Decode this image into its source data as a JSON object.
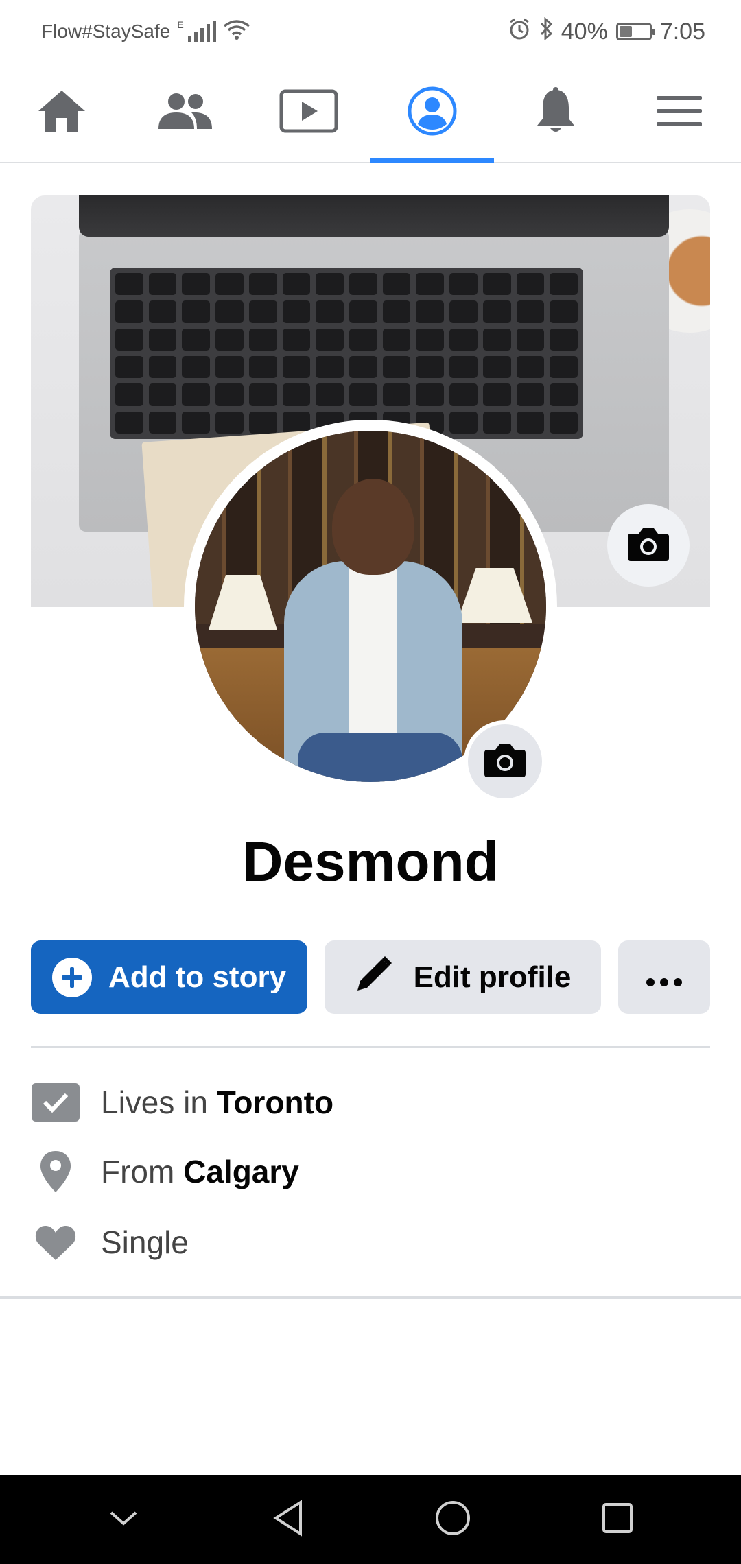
{
  "status_bar": {
    "carrier": "Flow#StaySafe",
    "network_type": "E",
    "battery_percent": "40%",
    "battery_level": 0.4,
    "time": "7:05",
    "icons": [
      "signal-icon",
      "wifi-icon",
      "alarm-icon",
      "bluetooth-icon",
      "battery-icon"
    ]
  },
  "top_nav": {
    "active_tab": "profile",
    "tabs": [
      {
        "name": "home",
        "icon": "home-icon"
      },
      {
        "name": "friends",
        "icon": "friends-icon"
      },
      {
        "name": "watch",
        "icon": "video-icon"
      },
      {
        "name": "profile",
        "icon": "profile-icon"
      },
      {
        "name": "notifications",
        "icon": "bell-icon"
      },
      {
        "name": "menu",
        "icon": "menu-icon"
      }
    ]
  },
  "profile": {
    "name": "Desmond",
    "cover_camera_icon": "camera-icon",
    "avatar_camera_icon": "camera-icon"
  },
  "actions": {
    "add_story_label": "Add to story",
    "edit_profile_label": "Edit profile",
    "more_icon": "more-icon"
  },
  "intro": {
    "lives_prefix": "Lives in",
    "lives_city": "Toronto",
    "from_prefix": "From",
    "from_city": "Calgary",
    "relationship": "Single"
  },
  "system_nav": {
    "buttons": [
      "collapse-icon",
      "back-icon",
      "home-icon",
      "recents-icon"
    ]
  },
  "colors": {
    "accent": "#2d88ff",
    "primary_button": "#1565c0",
    "secondary_button": "#e4e6eb",
    "icon_gray": "#65676b"
  }
}
